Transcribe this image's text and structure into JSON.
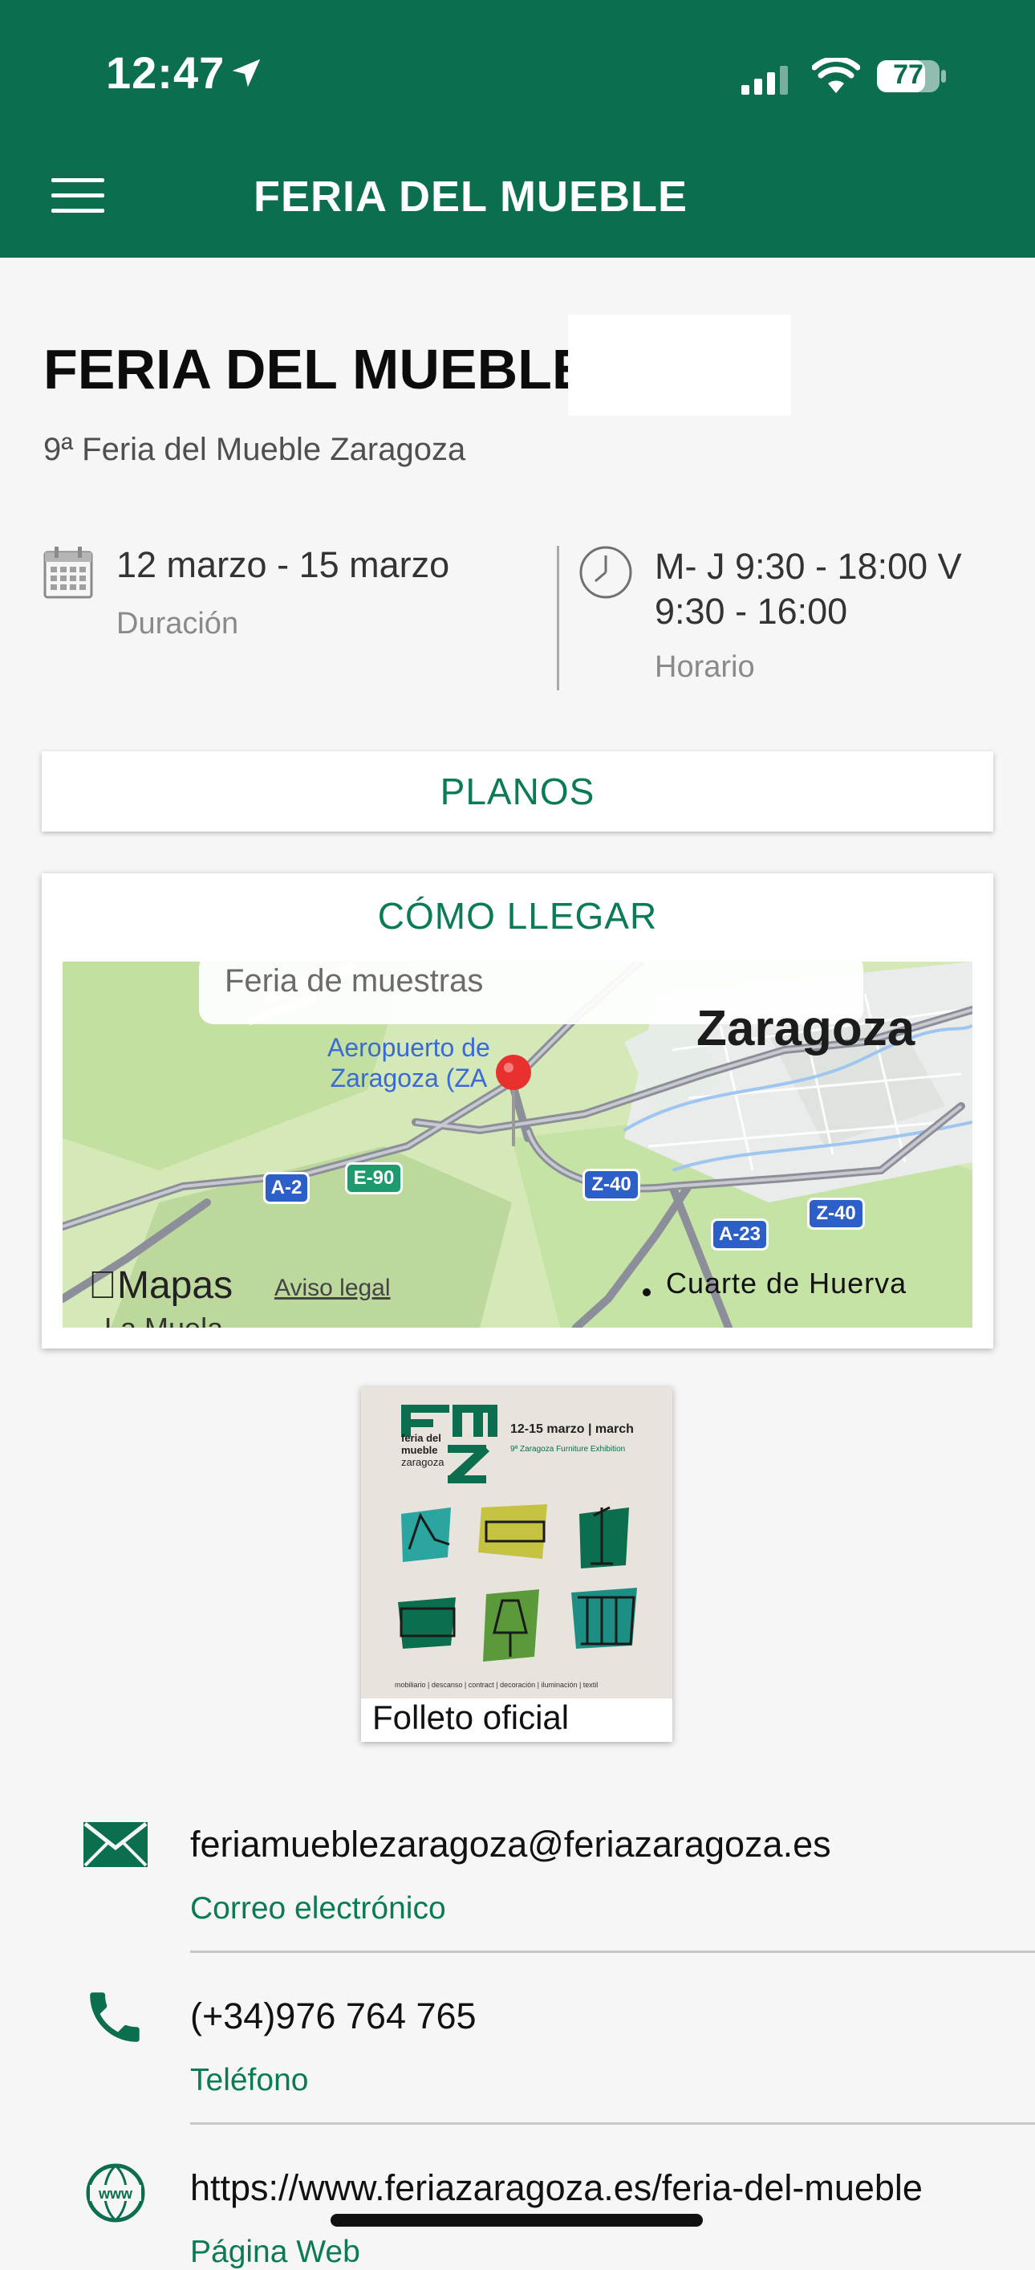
{
  "status_bar": {
    "time": "12:47",
    "battery": "77",
    "icons": [
      "location-arrow-icon",
      "cellular-signal-icon",
      "wifi-icon",
      "battery-icon"
    ]
  },
  "header": {
    "title": "FERIA DEL MUEBLE",
    "menu_icon": "hamburger-menu-icon",
    "background": "#0b6e4f"
  },
  "event": {
    "title": "FERIA DEL MUEBLE",
    "subtitle": "9ª Feria del Mueble Zaragoza",
    "dates": {
      "value": "12 marzo - 15 marzo",
      "label": "Duración",
      "icon": "calendar-icon"
    },
    "hours": {
      "value": "M- J 9:30 - 18:00 V 9:30 - 16:00",
      "label": "Horario",
      "icon": "clock-icon"
    }
  },
  "buttons": {
    "planos": "PLANOS",
    "como_llegar": "CÓMO LLEGAR"
  },
  "map": {
    "search_text": "Feria de muestras",
    "airport_label_1": "Aeropuerto de",
    "airport_label_2": "Zaragoza (ZA",
    "city": "Zaragoza",
    "town": "Cuarte de Huerva",
    "town2": "La Muela",
    "brand": "Mapas",
    "legal": "Aviso legal",
    "roads": [
      "A-2",
      "E-90",
      "Z-40",
      "A-23",
      "Z-40"
    ],
    "pin_color": "#e8302e"
  },
  "brochure": {
    "caption": "Folleto oficial",
    "cover_logo_lines": [
      "feria del",
      "mueble",
      "zaragoza"
    ],
    "cover_dates": "12-15 marzo | march",
    "cover_subtitle": "9ª Zaragoza Furniture Exhibition",
    "cover_footer": "mobiliario | descanso | contract | decoración | iluminación | textil"
  },
  "contacts": [
    {
      "value": "feriamueblezaragoza@feriazaragoza.es",
      "label": "Correo electrónico",
      "icon": "envelope-icon"
    },
    {
      "value": "(+34)976 764 765",
      "label": "Teléfono",
      "icon": "phone-icon"
    },
    {
      "value": "https://www.feriazaragoza.es/feria-del-mueble",
      "label": "Página Web",
      "icon": "www-globe-icon"
    }
  ],
  "colors": {
    "brand_green": "#0b6e4f",
    "accent_green": "#0b7a57"
  }
}
